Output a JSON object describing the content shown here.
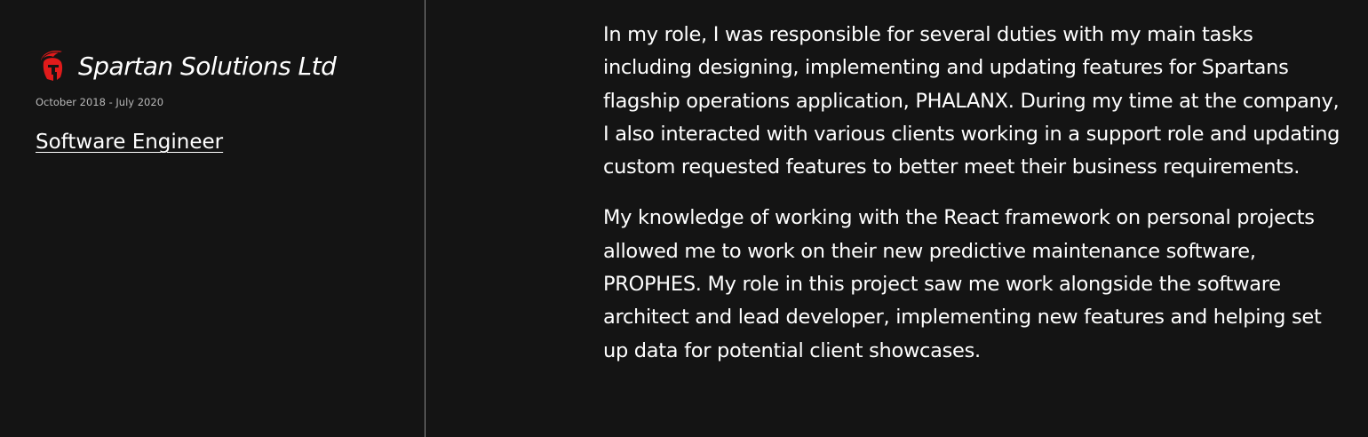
{
  "experience": {
    "company": "Spartan Solutions Ltd",
    "logo_icon": "spartan-helmet-icon",
    "dates": "October 2018 - July 2020",
    "job_title": "Software Engineer",
    "description": [
      "In my role, I was responsible for several duties with my main tasks including designing, implementing and updating features for Spartans flagship operations application, PHALANX. During my time at the company, I also interacted with various clients working in a support role and updating custom requested features to better meet their business requirements.",
      "My knowledge of working with the React framework on personal projects allowed me to work on their new predictive maintenance software, PROPHES. My role in this project saw me work alongside the software architect and lead developer, implementing new features and helping set up data for potential client showcases."
    ]
  },
  "colors": {
    "background": "#141414",
    "text": "#ffffff",
    "muted_text": "#b8b8b8",
    "divider": "#8a8a8a",
    "logo_red": "#e01b1b"
  }
}
